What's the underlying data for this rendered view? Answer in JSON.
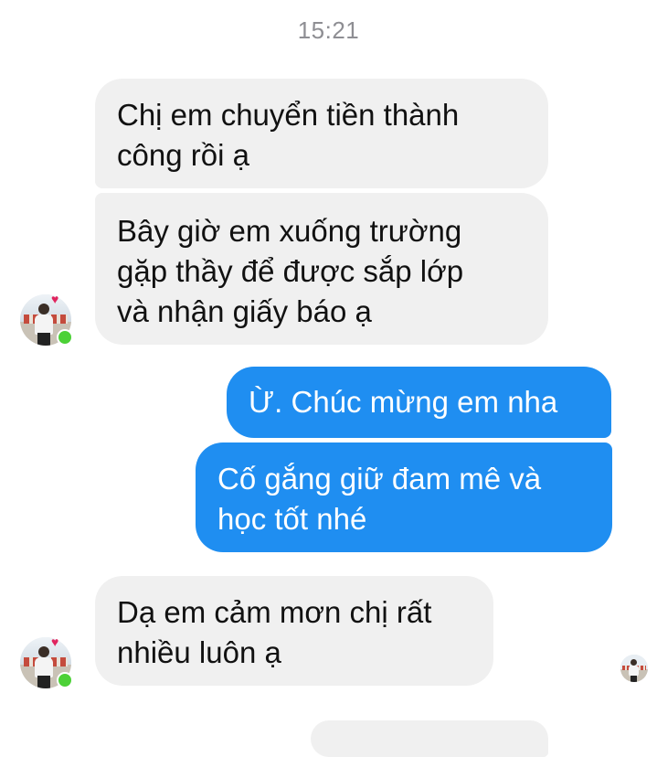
{
  "chat": {
    "timestamp": "15:21",
    "messages": [
      {
        "sender": "contact",
        "text": "Chị em chuyển tiền thành\ncông rồi ạ"
      },
      {
        "sender": "contact",
        "text": "Bây giờ em xuống trường\ngặp thầy để được sắp lớp\nvà nhận giấy báo ạ"
      },
      {
        "sender": "me",
        "text": "Ừ. Chúc mừng em nha"
      },
      {
        "sender": "me",
        "text": "Cố gắng giữ đam mê và\nhọc tốt nhé"
      },
      {
        "sender": "contact",
        "text": "Dạ em cảm mơn chị rất\nnhiều luôn ạ"
      }
    ]
  },
  "colors": {
    "incoming_bubble": "#f0f0f0",
    "outgoing_bubble": "#1f8ef1",
    "timestamp_text": "#8e8e93",
    "online_indicator": "#4cd137",
    "heart": "#e0245e"
  },
  "icons": {
    "contact_avatar": "contact-avatar-photo",
    "heart_badge": "heart-icon",
    "online_status": "online-status-icon",
    "seen_receipt": "seen-avatar-icon"
  }
}
